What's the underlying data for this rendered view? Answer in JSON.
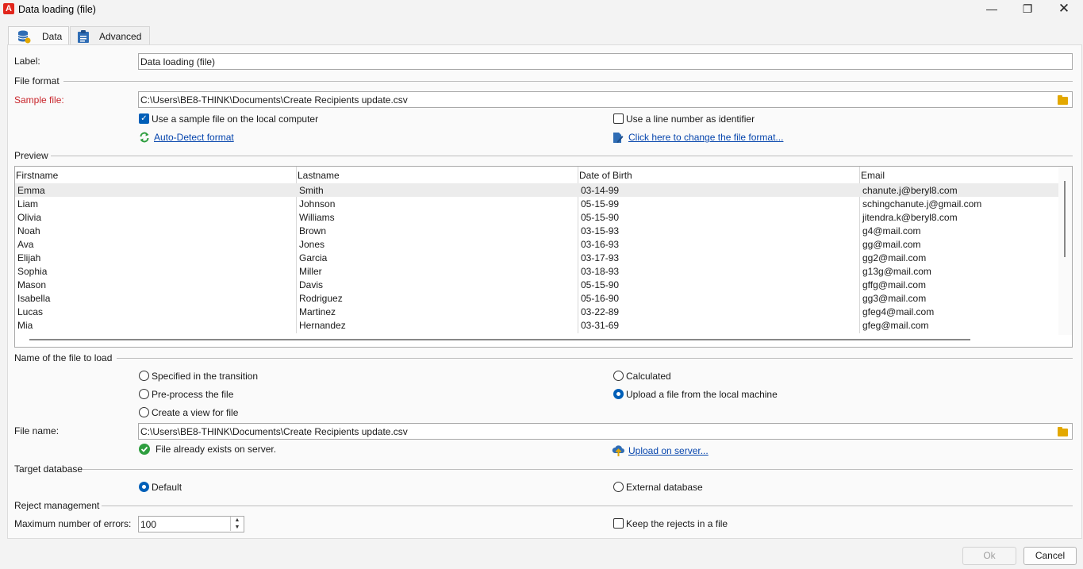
{
  "window": {
    "title": "Data loading (file)",
    "logo": "A"
  },
  "tabs": [
    {
      "label": "Data",
      "icon": "database-icon",
      "active": true
    },
    {
      "label": "Advanced",
      "icon": "clipboard-icon",
      "active": false
    }
  ],
  "label_field": {
    "label": "Label:",
    "value": "Data loading (file)"
  },
  "file_format": {
    "title": "File format",
    "sample_label": "Sample file:",
    "sample_value": "C:\\Users\\BE8-THINK\\Documents\\Create Recipients update.csv",
    "use_local_sample": {
      "label": "Use a sample file on the local computer",
      "checked": true
    },
    "use_line_number": {
      "label": "Use a line number as identifier",
      "checked": false
    },
    "auto_detect": "Auto-Detect format",
    "change_format": "Click here to change the file format..."
  },
  "preview": {
    "title": "Preview",
    "columns": [
      "Firstname",
      "Lastname",
      "Date of Birth",
      "Email"
    ],
    "rows": [
      [
        "Emma",
        "Smith",
        "03-14-99",
        "chanute.j@beryl8.com"
      ],
      [
        "Liam",
        "Johnson",
        "05-15-99",
        "schingchanute.j@gmail.com"
      ],
      [
        "Olivia",
        "Williams",
        "05-15-90",
        "jitendra.k@beryl8.com"
      ],
      [
        "Noah",
        "Brown",
        "03-15-93",
        "g4@mail.com"
      ],
      [
        "Ava",
        "Jones",
        "03-16-93",
        "gg@mail.com"
      ],
      [
        "Elijah",
        "Garcia",
        "03-17-93",
        "gg2@mail.com"
      ],
      [
        "Sophia",
        "Miller",
        "03-18-93",
        "g13g@mail.com"
      ],
      [
        "Mason",
        "Davis",
        "05-15-90",
        "gffg@mail.com"
      ],
      [
        "Isabella",
        "Rodriguez",
        "05-16-90",
        "gg3@mail.com"
      ],
      [
        "Lucas",
        "Martinez",
        "03-22-89",
        "gfeg4@mail.com"
      ],
      [
        "Mia",
        "Hernandez",
        "03-31-69",
        "gfeg@mail.com"
      ]
    ]
  },
  "file_to_load": {
    "title": "Name of the file to load",
    "options": {
      "specified": {
        "label": "Specified in the transition",
        "checked": false
      },
      "calculated": {
        "label": "Calculated",
        "checked": false
      },
      "preprocess": {
        "label": "Pre-process the file",
        "checked": false
      },
      "upload_local": {
        "label": "Upload a file from the local machine",
        "checked": true
      },
      "create_view": {
        "label": "Create a view for file",
        "checked": false
      }
    },
    "file_name_label": "File name:",
    "file_name_value": "C:\\Users\\BE8-THINK\\Documents\\Create Recipients update.csv",
    "status": "File already exists on server.",
    "upload_link": "Upload on server..."
  },
  "target_db": {
    "title": "Target database",
    "default": {
      "label": "Default",
      "checked": true
    },
    "external": {
      "label": "External database",
      "checked": false
    }
  },
  "reject": {
    "title": "Reject management",
    "max_errors_label": "Maximum number of errors:",
    "max_errors_value": "100",
    "keep_rejects": {
      "label": "Keep the rejects in a file",
      "checked": false
    }
  },
  "buttons": {
    "ok": "Ok",
    "cancel": "Cancel"
  },
  "colors": {
    "accent": "#005fb8",
    "error_label": "#c8252b",
    "link": "#0645ad",
    "success": "#2e9e3f"
  }
}
